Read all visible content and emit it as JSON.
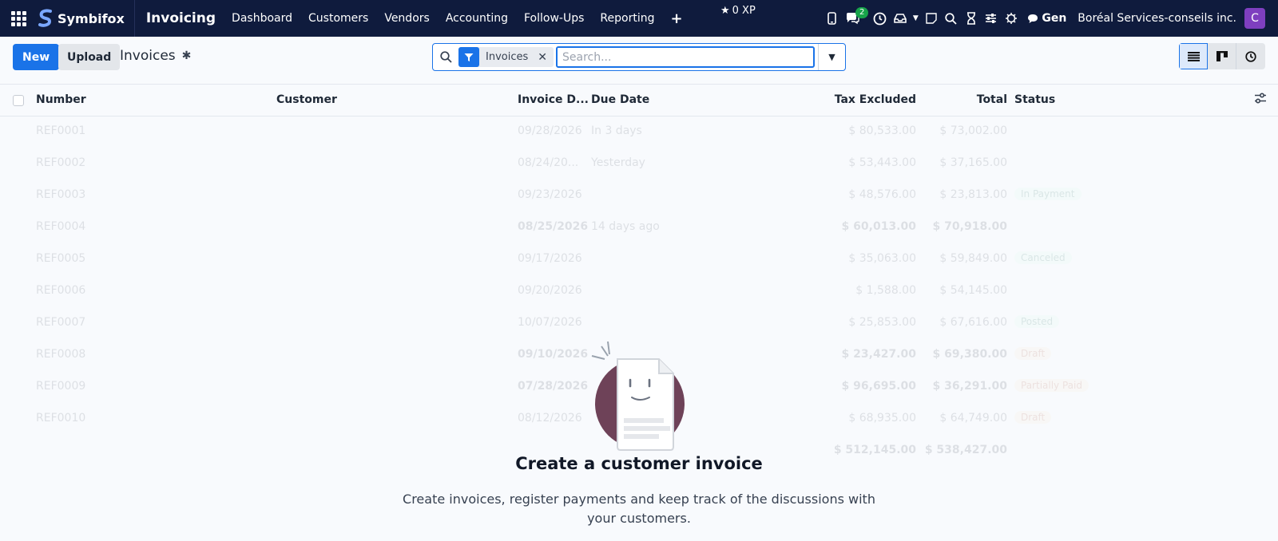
{
  "navbar": {
    "brand": "Symbifox",
    "app_name": "Invoicing",
    "menu": [
      "Dashboard",
      "Customers",
      "Vendors",
      "Accounting",
      "Follow-Ups",
      "Reporting"
    ],
    "xp": "0 XP",
    "chat_badge": "2",
    "gen_label": "Gen",
    "company": "Boréal Services-conseils inc.",
    "avatar_letter": "C"
  },
  "control": {
    "new_label": "New",
    "upload_label": "Upload",
    "breadcrumb": "Invoices",
    "facet_label": "Invoices",
    "search_placeholder": "Search..."
  },
  "table": {
    "columns": [
      "Number",
      "Customer",
      "Invoice D...",
      "Due Date",
      "Tax Excluded",
      "Total",
      "Status"
    ],
    "rows": [
      {
        "number": "REF0001",
        "date": "09/28/2026",
        "due": "In 3 days",
        "tax": "$ 80,533.00",
        "total": "$ 73,002.00",
        "status": "",
        "bold": false
      },
      {
        "number": "REF0002",
        "date": "08/24/20...",
        "due": "Yesterday",
        "tax": "$ 53,443.00",
        "total": "$ 37,165.00",
        "status": "",
        "bold": false
      },
      {
        "number": "REF0003",
        "date": "09/23/2026",
        "due": "",
        "tax": "$ 48,576.00",
        "total": "$ 23,813.00",
        "status": "In Payment",
        "bold": false
      },
      {
        "number": "REF0004",
        "date": "08/25/2026",
        "due": "14 days ago",
        "tax": "$ 60,013.00",
        "total": "$ 70,918.00",
        "status": "",
        "bold": true
      },
      {
        "number": "REF0005",
        "date": "09/17/2026",
        "due": "",
        "tax": "$ 35,063.00",
        "total": "$ 59,849.00",
        "status": "Canceled",
        "bold": false
      },
      {
        "number": "REF0006",
        "date": "09/20/2026",
        "due": "",
        "tax": "$ 1,588.00",
        "total": "$ 54,145.00",
        "status": "",
        "bold": false
      },
      {
        "number": "REF0007",
        "date": "10/07/2026",
        "due": "",
        "tax": "$ 25,853.00",
        "total": "$ 67,616.00",
        "status": "Posted",
        "bold": false
      },
      {
        "number": "REF0008",
        "date": "09/10/2026",
        "due": "",
        "tax": "$ 23,427.00",
        "total": "$ 69,380.00",
        "status": "Draft",
        "bold": true
      },
      {
        "number": "REF0009",
        "date": "07/28/2026",
        "due": "",
        "tax": "$ 96,695.00",
        "total": "$ 36,291.00",
        "status": "Partially Paid",
        "bold": true
      },
      {
        "number": "REF0010",
        "date": "08/12/2026",
        "due": "",
        "tax": "$ 68,935.00",
        "total": "$ 64,749.00",
        "status": "Draft",
        "bold": false
      }
    ],
    "footer_tax": "$ 512,145.00",
    "footer_total": "$ 538,427.00"
  },
  "help": {
    "title": "Create a customer invoice",
    "description": "Create invoices, register payments and keep track of the discussions with your customers."
  },
  "colors": {
    "navbar_bg": "#0f1b3d",
    "primary": "#1a73e8",
    "avatar": "#7e3fbf",
    "badge": "#17a34a"
  }
}
